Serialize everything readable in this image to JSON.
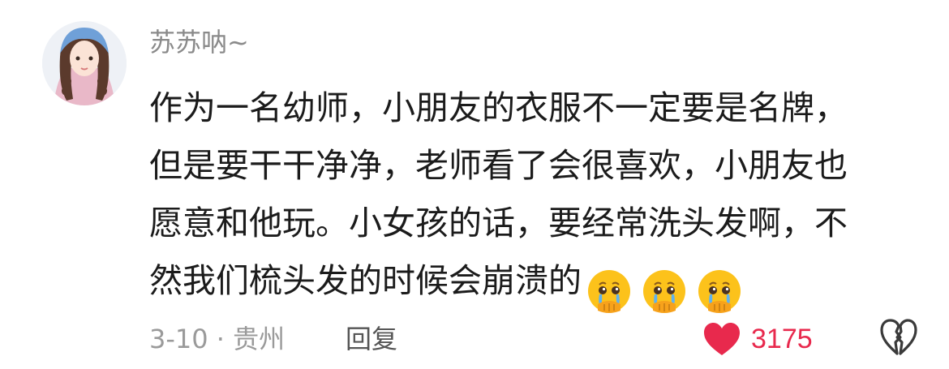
{
  "comment": {
    "avatar_icon": "avatar-girl-illustration",
    "username": "苏苏呐~",
    "lines": [
      "作为一名幼师，小朋友的衣服不一定要是名牌，",
      "但是要干干净净，老师看了会很喜欢，小朋友也",
      "愿意和他玩。小女孩的话，要经常洗头发啊，不",
      "然我们梳头发的时候会崩溃的"
    ],
    "emojis": [
      "crying-pleading-face-emoji",
      "crying-pleading-face-emoji",
      "crying-pleading-face-emoji"
    ],
    "meta": "3-10 · 贵州",
    "reply_label": "回复",
    "like_count": "3175",
    "like_color": "#e8294d",
    "dislike_icon": "broken-heart-icon"
  }
}
